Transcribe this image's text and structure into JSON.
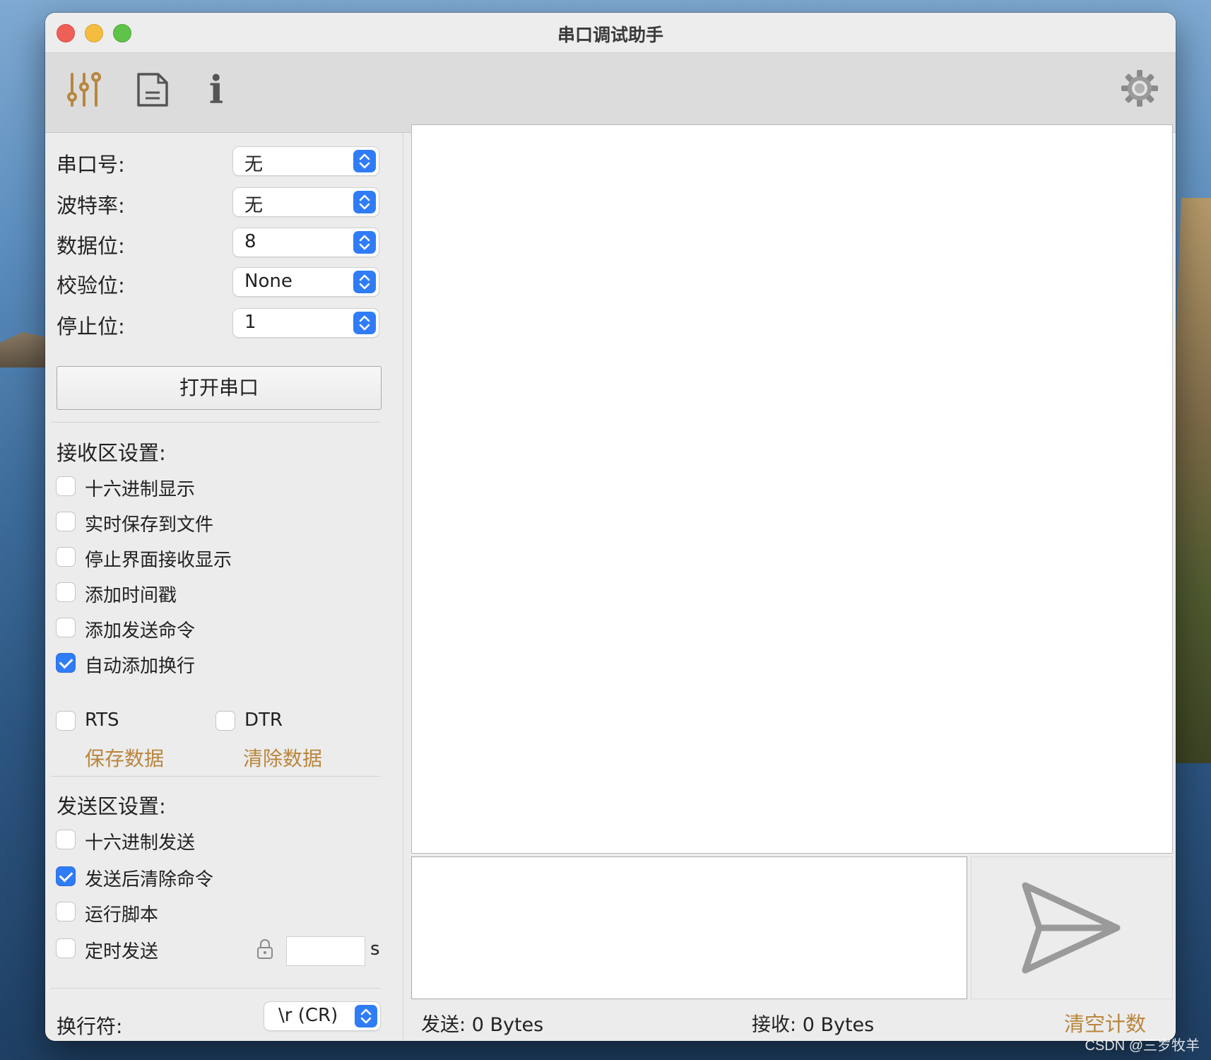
{
  "window": {
    "title": "串口调试助手"
  },
  "toolbar": {
    "icons": [
      "sliders-icon",
      "document-icon",
      "info-icon",
      "gear-icon"
    ],
    "info_glyph": "i"
  },
  "serial": {
    "port_label": "串口号:",
    "port_value": "无",
    "baud_label": "波特率:",
    "baud_value": "无",
    "databits_label": "数据位:",
    "databits_value": "8",
    "parity_label": "校验位:",
    "parity_value": "None",
    "stopbits_label": "停止位:",
    "stopbits_value": "1",
    "open_button": "打开串口"
  },
  "receive_settings": {
    "title": "接收区设置:",
    "options": [
      {
        "label": "十六进制显示",
        "checked": false
      },
      {
        "label": "实时保存到文件",
        "checked": false
      },
      {
        "label": "停止界面接收显示",
        "checked": false
      },
      {
        "label": "添加时间戳",
        "checked": false
      },
      {
        "label": "添加发送命令",
        "checked": false
      },
      {
        "label": "自动添加换行",
        "checked": true
      }
    ],
    "rts_label": "RTS",
    "rts_checked": false,
    "dtr_label": "DTR",
    "dtr_checked": false,
    "save_data": "保存数据",
    "clear_data": "清除数据"
  },
  "send_settings": {
    "title": "发送区设置:",
    "options": [
      {
        "label": "十六进制发送",
        "checked": false
      },
      {
        "label": "发送后清除命令",
        "checked": true
      },
      {
        "label": "运行脚本",
        "checked": false
      },
      {
        "label": "定时发送",
        "checked": false
      }
    ],
    "interval_value": "",
    "interval_unit": "s",
    "newline_label": "换行符:",
    "newline_value": "\\r  (CR)"
  },
  "status": {
    "send_label": "发送:",
    "send_value": "0 Bytes",
    "recv_label": "接收:",
    "recv_value": "0 Bytes",
    "clear_count": "清空计数"
  },
  "watermark": "CSDN @三岁牧羊",
  "colors": {
    "accent": "#2f7cf6",
    "link": "#b9863d"
  }
}
